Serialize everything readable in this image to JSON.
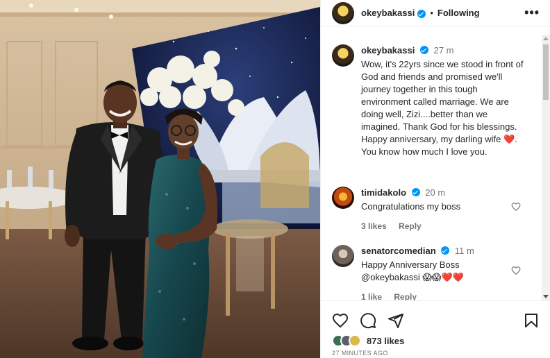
{
  "post": {
    "username": "okeybakassi",
    "follow_state": "Following",
    "separator": "•",
    "more_glyph": "•••"
  },
  "caption": {
    "username": "okeybakassi",
    "time": "27 m",
    "text": "Wow, it's 22yrs since we stood in front of God and friends and promised we'll journey together in this tough environment called marriage. We are doing well, Zizi....better than we imagined. Thank God for his blessings. Happy anniversary, my darling wife ❤️. You know how much I love you."
  },
  "comments": [
    {
      "username": "timidakolo",
      "time": "20 m",
      "text": "Congratulations my boss",
      "likes": "3 likes",
      "reply": "Reply"
    },
    {
      "username": "senatorcomedian",
      "time": "11 m",
      "text": "Happy Anniversary Boss\n@okeybakassi 😱😱❤️❤️",
      "likes": "1 like",
      "reply": "Reply"
    }
  ],
  "footer": {
    "likes": "873 likes",
    "ago": "27 MINUTES AGO"
  },
  "icons": {
    "like": "heart-icon",
    "comment": "comment-icon",
    "share": "share-icon",
    "save": "bookmark-icon",
    "verified": "verified-badge-icon",
    "more": "more-options-icon"
  },
  "colors": {
    "verified": "#0095f6",
    "text": "#262626",
    "secondary": "#737373",
    "border": "#efefef"
  }
}
